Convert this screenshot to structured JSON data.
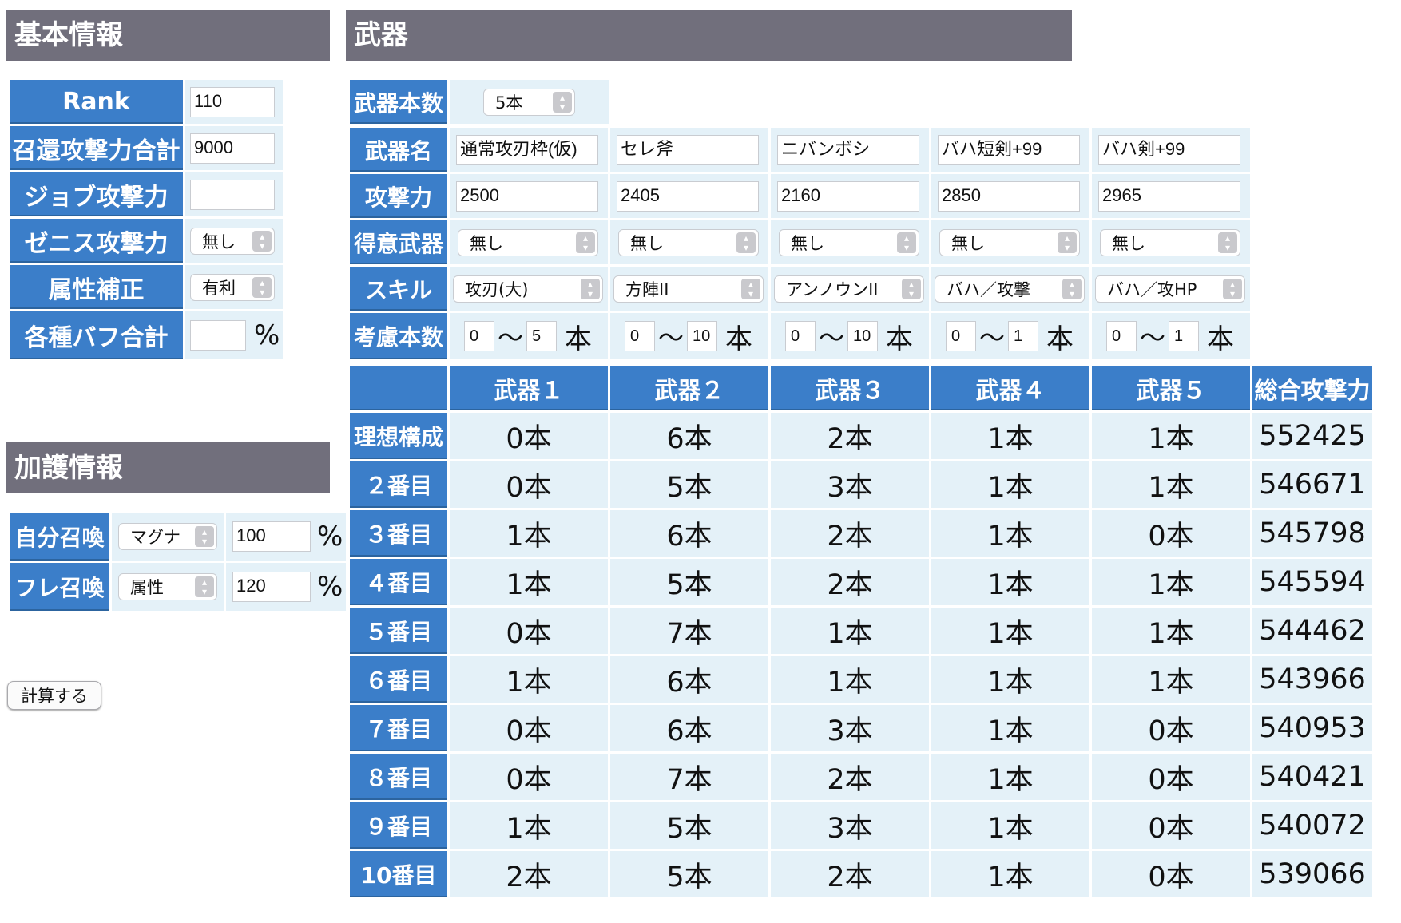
{
  "basic": {
    "header": "基本情報",
    "rows": [
      {
        "label": "Rank",
        "value": "110"
      },
      {
        "label": "召還攻撃力合計",
        "value": "9000"
      },
      {
        "label": "ジョブ攻撃力",
        "value": ""
      },
      {
        "label": "ゼニス攻撃力",
        "select": "無し"
      },
      {
        "label": "属性補正",
        "select": "有利"
      },
      {
        "label": "各種バフ合計",
        "value": "",
        "unit": "%"
      }
    ]
  },
  "kago": {
    "header": "加護情報",
    "rows": [
      {
        "label": "自分召喚",
        "select": "マグナ",
        "value": "100",
        "unit": "%"
      },
      {
        "label": "フレ召喚",
        "select": "属性",
        "value": "120",
        "unit": "%"
      }
    ]
  },
  "calc_button": "計算する",
  "weapons": {
    "header": "武器",
    "count_label": "武器本数",
    "count_value": "5本",
    "name_label": "武器名",
    "attack_label": "攻撃力",
    "tokui_label": "得意武器",
    "skill_label": "スキル",
    "consider_label": "考慮本数",
    "tilde": "〜",
    "hon": "本",
    "list": [
      {
        "name": "通常攻刃枠(仮)",
        "attack": "2500",
        "tokui": "無し",
        "skill": "攻刃(大)",
        "min": "0",
        "max": "5"
      },
      {
        "name": "セレ斧",
        "attack": "2405",
        "tokui": "無し",
        "skill": "方陣II",
        "min": "0",
        "max": "10"
      },
      {
        "name": "ニバンボシ",
        "attack": "2160",
        "tokui": "無し",
        "skill": "アンノウンII",
        "min": "0",
        "max": "10"
      },
      {
        "name": "バハ短剣+99",
        "attack": "2850",
        "tokui": "無し",
        "skill": "バハ／攻撃",
        "min": "0",
        "max": "1"
      },
      {
        "name": "バハ剣+99",
        "attack": "2965",
        "tokui": "無し",
        "skill": "バハ／攻HP",
        "min": "0",
        "max": "1"
      }
    ]
  },
  "results": {
    "headers": [
      "武器１",
      "武器２",
      "武器３",
      "武器４",
      "武器５",
      "総合攻撃力"
    ],
    "rows": [
      {
        "label": "理想構成",
        "cells": [
          "0本",
          "6本",
          "2本",
          "1本",
          "1本",
          "552425"
        ]
      },
      {
        "label": "２番目",
        "cells": [
          "0本",
          "5本",
          "3本",
          "1本",
          "1本",
          "546671"
        ]
      },
      {
        "label": "３番目",
        "cells": [
          "1本",
          "6本",
          "2本",
          "1本",
          "0本",
          "545798"
        ]
      },
      {
        "label": "４番目",
        "cells": [
          "1本",
          "5本",
          "2本",
          "1本",
          "1本",
          "545594"
        ]
      },
      {
        "label": "５番目",
        "cells": [
          "0本",
          "7本",
          "1本",
          "1本",
          "1本",
          "544462"
        ]
      },
      {
        "label": "６番目",
        "cells": [
          "1本",
          "6本",
          "1本",
          "1本",
          "1本",
          "543966"
        ]
      },
      {
        "label": "７番目",
        "cells": [
          "0本",
          "6本",
          "3本",
          "1本",
          "0本",
          "540953"
        ]
      },
      {
        "label": "８番目",
        "cells": [
          "0本",
          "7本",
          "2本",
          "1本",
          "0本",
          "540421"
        ]
      },
      {
        "label": "９番目",
        "cells": [
          "1本",
          "5本",
          "3本",
          "1本",
          "0本",
          "540072"
        ]
      },
      {
        "label": "10番目",
        "cells": [
          "2本",
          "5本",
          "2本",
          "1本",
          "0本",
          "539066"
        ]
      }
    ]
  }
}
